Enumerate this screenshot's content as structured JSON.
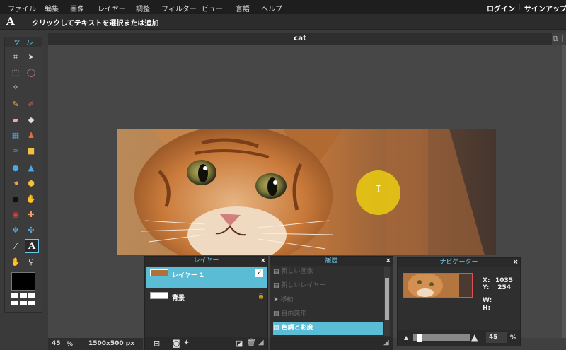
{
  "menu": {
    "items": [
      "ファイル",
      "編集",
      "画像",
      "レイヤー",
      "調整",
      "フィルター",
      "ビュー",
      "言語",
      "ヘルプ"
    ],
    "login": "ログイン",
    "separator": "|",
    "signup": "サインアップ"
  },
  "options": {
    "tool_glyph": "A",
    "hint": "クリックしてテキストを選択または追加"
  },
  "toolbox": {
    "title": "ツール",
    "tools": [
      "crop-icon",
      "move-icon",
      "marquee-icon",
      "lasso-icon",
      "magic-wand-icon",
      "pencil-icon",
      "brush-icon",
      "eraser-icon",
      "paint-bucket-icon",
      "gradient-icon",
      "clone-stamp-icon",
      "color-replace-icon",
      "shape-icon",
      "blur-drop-icon",
      "sharpen-icon",
      "smudge-icon",
      "sponge-icon",
      "burn-icon",
      "dodge-icon",
      "red-eye-icon",
      "spot-heal-icon",
      "bloat-icon",
      "pinch-icon",
      "color-picker-icon",
      "type-icon",
      "hand-icon",
      "zoom-icon"
    ],
    "primary_color": "#000000",
    "secondary_color": "#ffffff"
  },
  "document": {
    "title": "cat",
    "zoom": "45",
    "zoom_unit": "%",
    "size": "1500x500 px"
  },
  "layers": {
    "title": "レイヤー",
    "items": [
      {
        "name": "レイヤー 1",
        "selected": true,
        "visible": true
      },
      {
        "name": "背景",
        "selected": false,
        "locked": true
      }
    ],
    "close": "×"
  },
  "history": {
    "title": "履歴",
    "items": [
      "新しい画像",
      "新しいレイヤー",
      "移動",
      "自由変形",
      "色調と彩度"
    ],
    "active_index": 4,
    "close": "×"
  },
  "navigator": {
    "title": "ナビゲーター",
    "x_label": "X:",
    "x_value": "1035",
    "y_label": "Y:",
    "y_value": "254",
    "w_label": "W:",
    "h_label": "H:",
    "zoom": "45",
    "zoom_unit": "%",
    "close": "×"
  },
  "colors": {
    "accent": "#5bbcd6",
    "cursor": "#e4c414"
  }
}
